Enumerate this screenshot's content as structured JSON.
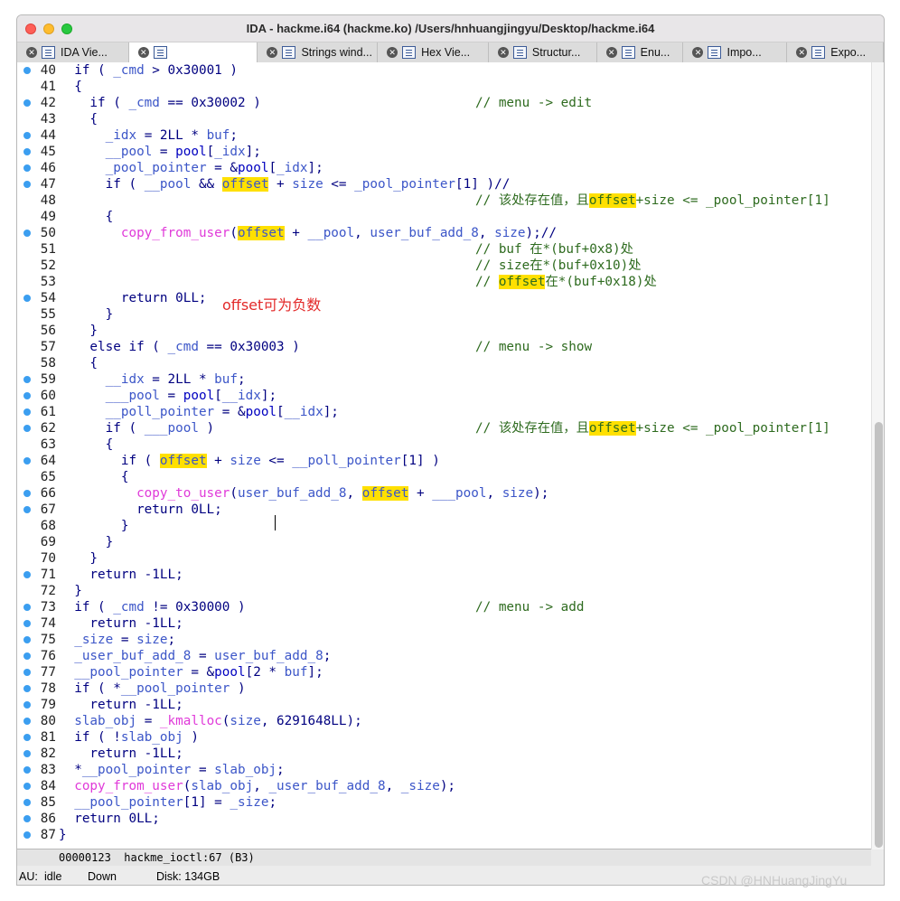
{
  "window": {
    "title": "IDA - hackme.i64 (hackme.ko) /Users/hnhuangjingyu/Desktop/hackme.i64",
    "colors": {
      "highlight": "#ffe000",
      "comment": "#2e6b1f",
      "function": "#e03ad9",
      "variable": "#3c56c8",
      "keyword": "#000080",
      "breakpoint": "#3b9ef0",
      "annotation": "#e32a2a"
    }
  },
  "tabs": [
    {
      "label": "IDA Vie...",
      "icon": "ida-view-icon"
    },
    {
      "label": "",
      "icon": "pseudocode-icon"
    },
    {
      "label": "Strings wind...",
      "icon": "strings-icon"
    },
    {
      "label": "Hex Vie...",
      "icon": "hex-view-icon"
    },
    {
      "label": "Structur...",
      "icon": "structures-icon"
    },
    {
      "label": "Enu...",
      "icon": "enums-icon"
    },
    {
      "label": "Impo...",
      "icon": "imports-icon"
    },
    {
      "label": "Expo...",
      "icon": "exports-icon"
    }
  ],
  "code": {
    "l40": {
      "n": "40",
      "a": "  if ( ",
      "b": "_cmd",
      "c": " > 0x30001 )"
    },
    "l41": {
      "n": "41",
      "a": "  {"
    },
    "l42": {
      "n": "42",
      "a": "    if ( ",
      "b": "_cmd",
      "c": " == 0x30002 )",
      "cmt": "// menu -> edit"
    },
    "l43": {
      "n": "43",
      "a": "    {"
    },
    "l44": {
      "n": "44",
      "a": "      ",
      "b": "_idx",
      "c": " = 2LL * ",
      "d": "buf",
      "e": ";"
    },
    "l45": {
      "n": "45",
      "a": "      ",
      "b": "__pool",
      "c": " = ",
      "g": "pool",
      "d": "[",
      "e": "_idx",
      "f": "];"
    },
    "l46": {
      "n": "46",
      "a": "      ",
      "b": "_pool_pointer",
      "c": " = &",
      "g": "pool",
      "d": "[",
      "e": "_idx",
      "f": "];"
    },
    "l47": {
      "n": "47",
      "a": "      if ( ",
      "b": "__pool",
      "c": " && ",
      "h": "offset",
      "d": " + ",
      "e": "size",
      "f": " <= ",
      "g": "_pool_pointer",
      "i": "[1] )//"
    },
    "l48": {
      "n": "48",
      "c1": "// 该处存在值，且",
      "c2": "offset",
      "c3": "+size <= _pool_pointer[1]"
    },
    "l49": {
      "n": "49",
      "a": "      {"
    },
    "l50": {
      "n": "50",
      "a": "        ",
      "f1": "copy_from_user",
      "p": "(",
      "h": "offset",
      "c": " + ",
      "b": "__pool",
      "d": ", ",
      "e": "user_buf_add_8",
      "f": ", ",
      "g": "size",
      "i": ");//"
    },
    "l51": {
      "n": "51",
      "cmt": "// buf 在*(buf+0x8)处"
    },
    "l52": {
      "n": "52",
      "cmt": "// size在*(buf+0x10)处"
    },
    "l53": {
      "n": "53",
      "c1": "// ",
      "c2": "offset",
      "c3": "在*(buf+0x18)处"
    },
    "l54": {
      "n": "54",
      "a": "        return 0LL;"
    },
    "l55": {
      "n": "55",
      "a": "      }"
    },
    "l56": {
      "n": "56",
      "a": "    }"
    },
    "l57": {
      "n": "57",
      "a": "    else if ( ",
      "b": "_cmd",
      "c": " == 0x30003 )",
      "cmt": "// menu -> show"
    },
    "l58": {
      "n": "58",
      "a": "    {"
    },
    "l59": {
      "n": "59",
      "a": "      ",
      "b": "__idx",
      "c": " = 2LL * ",
      "d": "buf",
      "e": ";"
    },
    "l60": {
      "n": "60",
      "a": "      ",
      "b": "___pool",
      "c": " = ",
      "g": "pool",
      "d": "[",
      "e": "__idx",
      "f": "];"
    },
    "l61": {
      "n": "61",
      "a": "      ",
      "b": "__poll_pointer",
      "c": " = &",
      "g": "pool",
      "d": "[",
      "e": "__idx",
      "f": "];"
    },
    "l62": {
      "n": "62",
      "a": "      if ( ",
      "b": "___pool",
      "c": " )",
      "c1": "// 该处存在值，且",
      "c2": "offset",
      "c3": "+size <= _pool_pointer[1]"
    },
    "l63": {
      "n": "63",
      "a": "      {"
    },
    "l64": {
      "n": "64",
      "a": "        if ( ",
      "h": "offset",
      "c": " + ",
      "b": "size",
      "d": " <= ",
      "e": "__poll_pointer",
      "f": "[1] )"
    },
    "l65": {
      "n": "65",
      "a": "        {"
    },
    "l66": {
      "n": "66",
      "a": "          ",
      "f1": "copy_to_user",
      "p": "(",
      "b": "user_buf_add_8",
      "c": ", ",
      "h": "offset",
      "d": " + ",
      "e": "___pool",
      "f": ", ",
      "g": "size",
      "i": ");"
    },
    "l67": {
      "n": "67",
      "a": "          return 0LL;"
    },
    "l68": {
      "n": "68",
      "a": "        }"
    },
    "l69": {
      "n": "69",
      "a": "      }"
    },
    "l70": {
      "n": "70",
      "a": "    }"
    },
    "l71": {
      "n": "71",
      "a": "    return -1LL;"
    },
    "l72": {
      "n": "72",
      "a": "  }"
    },
    "l73": {
      "n": "73",
      "a": "  if ( ",
      "b": "_cmd",
      "c": " != 0x30000 )",
      "cmt": "// menu -> add"
    },
    "l74": {
      "n": "74",
      "a": "    return -1LL;"
    },
    "l75": {
      "n": "75",
      "a": "  ",
      "b": "_size",
      "c": " = ",
      "d": "size",
      "e": ";"
    },
    "l76": {
      "n": "76",
      "a": "  ",
      "b": "_user_buf_add_8",
      "c": " = ",
      "d": "user_buf_add_8",
      "e": ";"
    },
    "l77": {
      "n": "77",
      "a": "  ",
      "b": "__pool_pointer",
      "c": " = &",
      "g": "pool",
      "d": "[2 * ",
      "e": "buf",
      "f": "];"
    },
    "l78": {
      "n": "78",
      "a": "  if ( *",
      "b": "__pool_pointer",
      "c": " )"
    },
    "l79": {
      "n": "79",
      "a": "    return -1LL;"
    },
    "l80": {
      "n": "80",
      "a": "  ",
      "b": "slab_obj",
      "c": " = ",
      "f1": "_kmalloc",
      "p": "(",
      "d": "size",
      "e": ", 6291648LL);"
    },
    "l81": {
      "n": "81",
      "a": "  if ( !",
      "b": "slab_obj",
      "c": " )"
    },
    "l82": {
      "n": "82",
      "a": "    return -1LL;"
    },
    "l83": {
      "n": "83",
      "a": "  *",
      "b": "__pool_pointer",
      "c": " = ",
      "d": "slab_obj",
      "e": ";"
    },
    "l84": {
      "n": "84",
      "a": "  ",
      "f1": "copy_from_user",
      "p": "(",
      "b": "slab_obj",
      "c": ", ",
      "d": "_user_buf_add_8",
      "e": ", ",
      "g": "_size",
      "f": ");"
    },
    "l85": {
      "n": "85",
      "a": "  ",
      "b": "__pool_pointer",
      "c": "[1] = ",
      "d": "_size",
      "e": ";"
    },
    "l86": {
      "n": "86",
      "a": "  return 0LL;"
    },
    "l87": {
      "n": "87",
      "a": "}"
    }
  },
  "annotation": "offset可为负数",
  "status_line": "00000123  hackme_ioctl:67 (B3)",
  "status_bar": {
    "au": "AU:",
    "au_state": "idle",
    "direction": "Down",
    "disk": "Disk: 134GB"
  },
  "watermark": "CSDN @HNHuangJingYu"
}
